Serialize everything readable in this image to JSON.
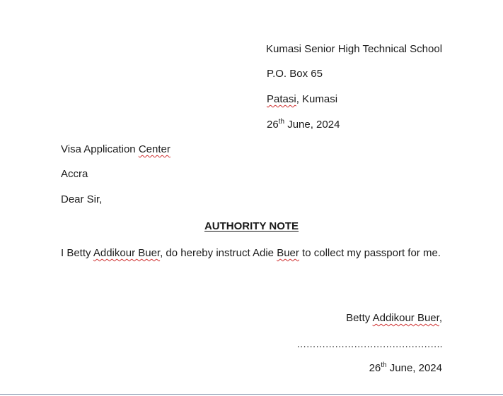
{
  "sender": {
    "school": "Kumasi Senior High Technical School",
    "po_box": "P.O. Box 65",
    "town_a": "Patasi",
    "town_b": ", Kumasi",
    "date_day": "26",
    "date_suffix": "th",
    "date_rest": " June, 2024"
  },
  "recipient": {
    "line1_a": "Visa Application ",
    "line1_b": "Center",
    "line2": "Accra"
  },
  "salutation": "Dear Sir,",
  "title": "AUTHORITY NOTE",
  "body": {
    "p1": "I Betty ",
    "p2": "Addikour Buer",
    "p3": ", do hereby instruct Adie ",
    "p4": "Buer",
    "p5": " to collect my passport for me."
  },
  "signature": {
    "name_a": "Betty ",
    "name_b": "Addikour Buer",
    "name_c": ",",
    "dots": "……………………………………….",
    "date_day": "26",
    "date_suffix": "th",
    "date_rest": " June, 2024"
  }
}
